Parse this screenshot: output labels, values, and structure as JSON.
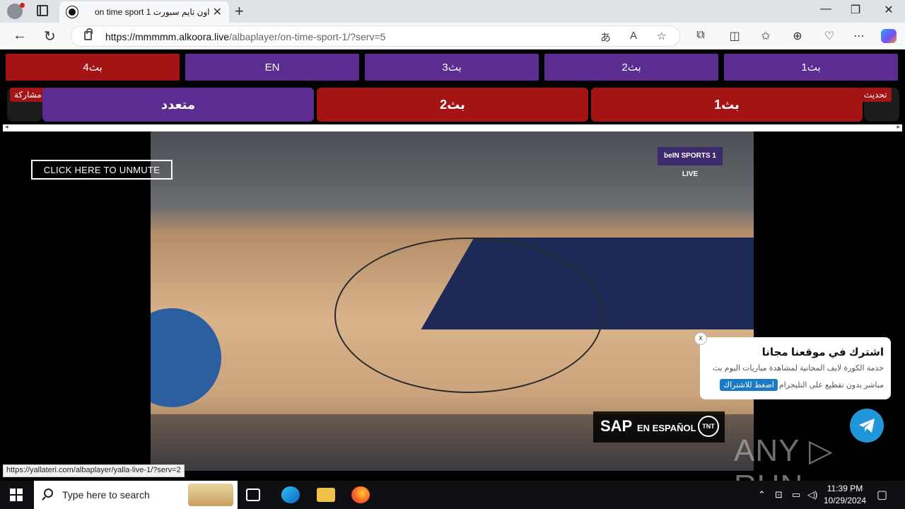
{
  "browser": {
    "tab_title": "on time sport 1 اون تايم سبورت",
    "url_host": "https://mmmmm.alkoora.live",
    "url_path": "/albaplayer/on-time-sport-1/?serv=5",
    "window_controls": [
      "—",
      "❐",
      "✕"
    ]
  },
  "page": {
    "server_row": [
      {
        "label": "بث4",
        "color": "#a31515"
      },
      {
        "label": "EN",
        "color": "#5c2d91"
      },
      {
        "label": "بث3",
        "color": "#5c2d91"
      },
      {
        "label": "بث2",
        "color": "#5c2d91"
      },
      {
        "label": "بث1",
        "color": "#5c2d91"
      }
    ],
    "stream_row": {
      "multi": "متعدد",
      "stream2": "بث2",
      "stream1": "بث1"
    },
    "share_tag": "مشاركة",
    "refresh_tag": "تحديث",
    "unmute_label": "CLICK HERE TO UNMUTE",
    "channel_logo": "beIN SPORTS 1 LIVE",
    "overlay_sap": "SAP",
    "overlay_espanol": "EN ESPAÑOL",
    "overlay_tnt": "TNT"
  },
  "popup": {
    "close": "x",
    "heading": "اشترك في موقعنا مجانا",
    "desc_line1": "خدمة الكورة لايف المجانية لمشاهدة مباريات اليوم بث",
    "desc_line2": "مباشر بدون تقطيع على التليجرام",
    "subscribe_button": "اضغط للاشتراك"
  },
  "watermark": "ANY ▷ RUN",
  "status_url": "https://yallateri.com/albaplayer/yalla-live-1/?serv=2",
  "taskbar": {
    "search_placeholder": "Type here to search",
    "time": "11:39 PM",
    "date": "10/29/2024"
  }
}
